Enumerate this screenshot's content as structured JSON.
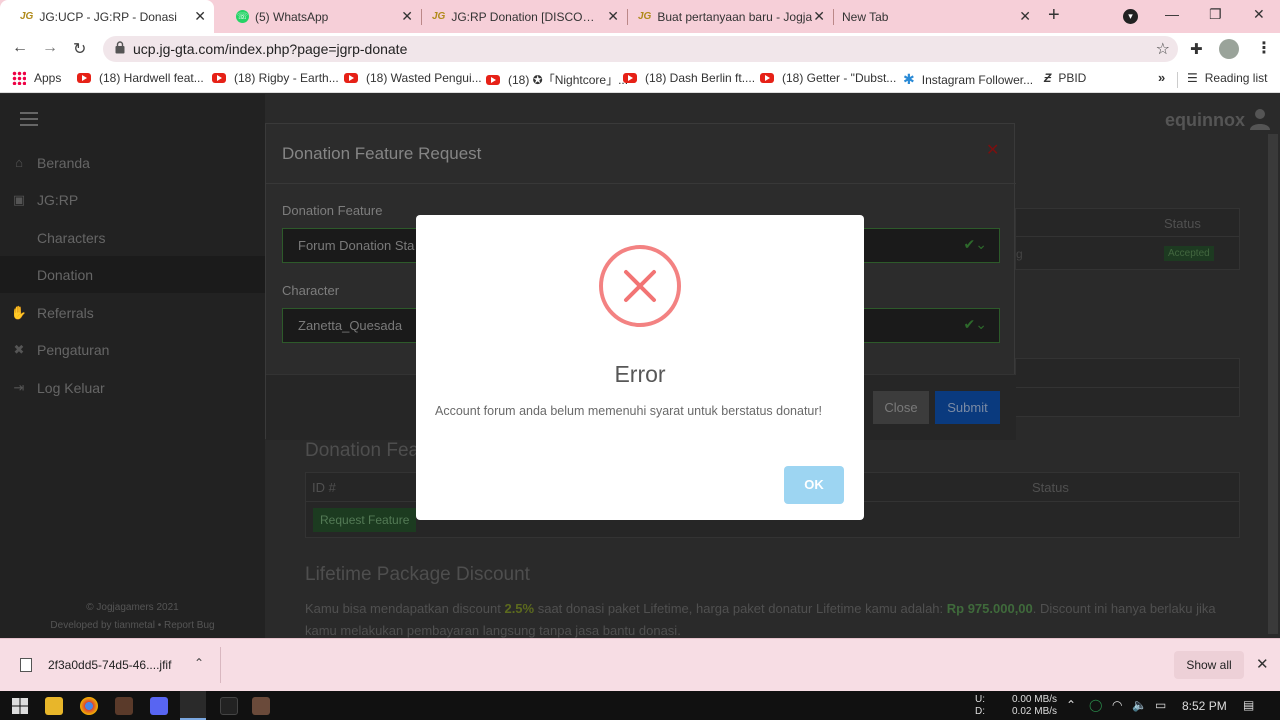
{
  "tabs": [
    {
      "label": "JG:UCP - JG:RP - Donasi",
      "fav": "JG",
      "active": true
    },
    {
      "label": "(5) WhatsApp",
      "fav": "wa"
    },
    {
      "label": "JG:RP Donation [DISCOUNT]",
      "fav": "JG"
    },
    {
      "label": "Buat pertanyaan baru - Jogja",
      "fav": "JG"
    },
    {
      "label": "New Tab",
      "fav": ""
    }
  ],
  "address": {
    "url": "ucp.jg-gta.com/index.php?page=jgrp-donate"
  },
  "bookmarks": [
    {
      "label": "Apps"
    },
    {
      "label": "(18) Hardwell feat..."
    },
    {
      "label": "(18) Rigby - Earth..."
    },
    {
      "label": "(18) Wasted Pengui..."
    },
    {
      "label": "(18) ✪「Nightcore」..."
    },
    {
      "label": "(18) Dash Berlin ft...."
    },
    {
      "label": "(18) Getter - \"Dubst..."
    },
    {
      "label": "Instagram Follower..."
    },
    {
      "label": "PBID"
    }
  ],
  "reading_list": "Reading list",
  "brand": "equinnox",
  "sidebar": {
    "items": [
      {
        "label": "Beranda",
        "icon": "home-icon"
      },
      {
        "label": "JG:RP",
        "icon": "game-icon"
      },
      {
        "label": "Characters",
        "icon": ""
      },
      {
        "label": "Donation",
        "icon": ""
      },
      {
        "label": "Referrals",
        "icon": "handshake-icon"
      },
      {
        "label": "Pengaturan",
        "icon": "wrench-icon"
      },
      {
        "label": "Log Keluar",
        "icon": "logout-icon"
      }
    ],
    "footer_line1": "© Jogjagamers 2021",
    "footer_dev": "Developed by tianmetal",
    "footer_sep": "•",
    "footer_report": "Report Bug"
  },
  "background": {
    "status_header": "Status",
    "badge_accepted": "Accepted",
    "donation_feature_heading": "Donation Fea",
    "col_id": "ID #",
    "col_status": "Status",
    "request_feature_btn": "Request Feature",
    "lifetime_heading": "Lifetime Package Discount",
    "lifetime_text_1": "Kamu bisa mendapatkan discount ",
    "discount": "2.5%",
    "lifetime_text_2": " saat donasi paket Lifetime, harga paket donatur Lifetime kamu adalah: ",
    "price": "Rp 975.000,00",
    "lifetime_text_3": ". Discount ini hanya berlaku jika kamu melakukan pembayaran langsung tanpa jasa bantu donasi."
  },
  "donation_modal": {
    "title": "Donation Feature Request",
    "feature_label": "Donation Feature",
    "feature_value": "Forum Donation Sta",
    "character_label": "Character",
    "character_value": "Zanetta_Quesada",
    "close_label": "Close",
    "submit_label": "Submit"
  },
  "error_dialog": {
    "title": "Error",
    "message": "Account forum anda belum memenuhi syarat untuk berstatus donatur!",
    "ok_label": "OK",
    "accent": "#f27474"
  },
  "download": {
    "filename": "2f3a0dd5-74d5-46....jfif",
    "show_all": "Show all"
  },
  "taskbar": {
    "net_up_label": "U:",
    "net_down_label": "D:",
    "up_speed": "0.00 MB/s",
    "down_speed": "0.02 MB/s",
    "time": "8:52 PM"
  }
}
